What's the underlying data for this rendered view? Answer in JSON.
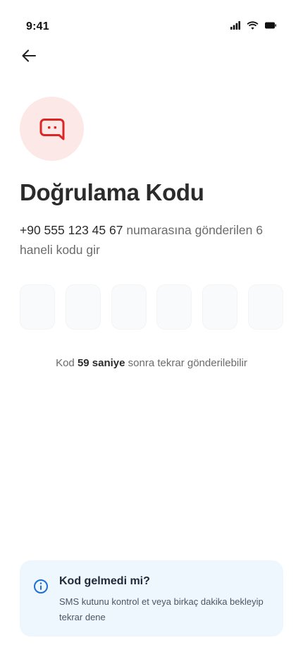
{
  "status_bar": {
    "time": "9:41",
    "icons": [
      "cellular-signal-icon",
      "wifi-icon",
      "battery-icon"
    ]
  },
  "header": {
    "back_icon": "arrow-left-icon"
  },
  "hero": {
    "icon": "chat-bubble-icon",
    "accent_color": "#dc2626",
    "background_color": "#fde8e8"
  },
  "title": "Doğrulama Kodu",
  "subtitle": {
    "phone": "+90 555 123 45 67",
    "text": " numarasına gönderilen 6 haneli kodu gir"
  },
  "code_input": {
    "digits": [
      "",
      "",
      "",
      "",
      "",
      ""
    ]
  },
  "resend": {
    "prefix": "Kod ",
    "seconds": "59 saniye",
    "suffix": " sonra tekrar gönderilebilir"
  },
  "info_card": {
    "icon": "info-icon",
    "title": "Kod gelmedi mi?",
    "text": "SMS kutunu kontrol et veya birkaç dakika bekleyip tekrar dene",
    "background_color": "#eef6fe",
    "icon_color": "#1d6fd6"
  }
}
